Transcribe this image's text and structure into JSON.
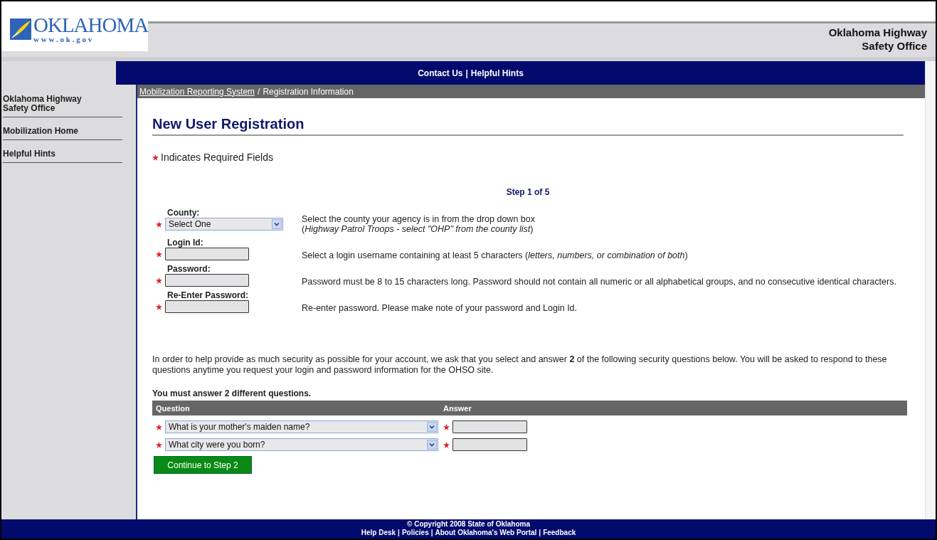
{
  "header": {
    "logo": {
      "name": "OKLAHOMA",
      "url": "w w w . o k . g o v"
    },
    "agency_lines": [
      "Oklahoma Highway",
      "Safety Office"
    ]
  },
  "top_nav": {
    "links": [
      {
        "label": "Contact Us"
      },
      {
        "label": "Helpful Hints"
      }
    ],
    "separator": "|"
  },
  "sidebar": {
    "items": [
      {
        "label": "Oklahoma Highway Safety Office"
      },
      {
        "label": "Mobilization Home"
      },
      {
        "label": "Helpful Hints"
      }
    ]
  },
  "breadcrumb": {
    "items": [
      {
        "label": "Mobilization Reporting System",
        "link": true
      },
      {
        "label": "Registration Information",
        "link": false
      }
    ],
    "separator": "/"
  },
  "title": "New User Registration",
  "required_note": "Indicates Required Fields",
  "step": "Step 1 of 5",
  "fields": [
    {
      "kind": "select",
      "label": "County:",
      "value": "Select One",
      "required": true,
      "help": [
        "Select the county your agency is in from the drop down box",
        "(*Highway Patrol Troops - select \"OHP\" from the county list*)"
      ]
    },
    {
      "kind": "text",
      "label": "Login Id:",
      "required": true,
      "help": [
        "Select a login username containing at least 5 characters (*letters, numbers, or combination of both*)"
      ]
    },
    {
      "kind": "text",
      "label": "Password:",
      "required": true,
      "help": [
        "Password must be 8 to 15 characters long. Password should not contain all numeric or all alphabetical groups, and no consecutive identical characters."
      ]
    },
    {
      "kind": "text",
      "label": "Re-Enter Password:",
      "required": true,
      "help": [
        "Re-enter password. Please make note of your password and Login Id."
      ]
    }
  ],
  "security_intro": "In order to help provide as much security as possible for your account, we ask that you select and answer **2** of the following security questions below. You will be asked to respond to these questions anytime you request your login and password information for the OHSO site.",
  "questions_heading": "You must answer 2 different questions.",
  "questions_table": {
    "columns": [
      "Question",
      "Answer"
    ],
    "rows": [
      {
        "question": "What is your mother's maiden name?",
        "required": true
      },
      {
        "question": "What city were you born?",
        "required": true
      }
    ]
  },
  "continue_button": "Continue to Step 2",
  "footer": {
    "copyright": "© Copyright 2008 State of Oklahoma",
    "links": [
      "Help Desk",
      "Policies",
      "About Oklahoma's Web Portal",
      "Feedback"
    ],
    "separator": "|"
  }
}
